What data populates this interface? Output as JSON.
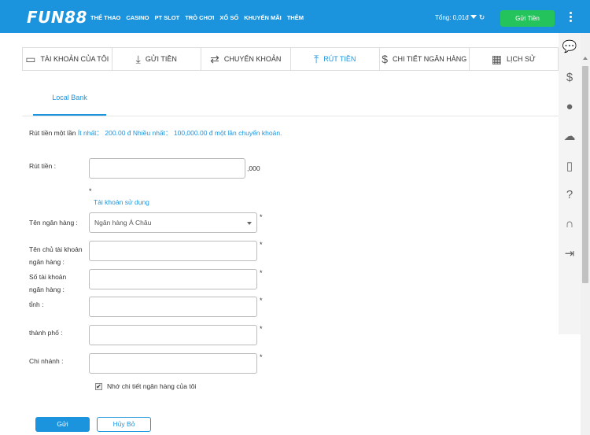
{
  "header": {
    "logo": "FUN88",
    "nav": [
      "THỂ THAO",
      "CASINO",
      "PT SLOT",
      "TRÒ CHƠI",
      "XỔ SỐ",
      "KHUYẾN MÃI",
      "THÊM"
    ],
    "balance": "Tổng: 0,01đ",
    "deposit_button": "Gửi Tiền"
  },
  "tabs": [
    {
      "label": "TÀI KHOẢN CỦA TÔI",
      "icon": "wallet-icon"
    },
    {
      "label": "GỬI TIỀN",
      "icon": "download-icon"
    },
    {
      "label": "CHUYỂN KHOẢN",
      "icon": "transfer-icon"
    },
    {
      "label": "RÚT TIỀN",
      "icon": "upload-icon",
      "active": true
    },
    {
      "label": "CHI TIẾT NGÂN HÀNG",
      "icon": "dollar-circle-icon"
    },
    {
      "label": "LỊCH SỬ",
      "icon": "calendar-icon"
    }
  ],
  "subtab": "Local Bank",
  "notice": {
    "prefix": "Rút tiền một lần",
    "min_label": "Ít nhất：",
    "min_value": "200.00 đ",
    "max_label": "Nhiều nhất：",
    "max_value": "100,000.00 đ một lần chuyển khoản."
  },
  "form": {
    "amount_label": "Rút tiền :",
    "amount_suffix": ",000",
    "account_asterisk": "*",
    "account_link": "Tài khoản sử dụng",
    "bank_label": "Tên ngân hàng :",
    "bank_selected": "Ngân hàng Á Châu",
    "holder_label_1": "Tên chủ tài khoản",
    "holder_label_2": "ngân hàng :",
    "number_label_1": "Số tài khoản",
    "number_label_2": "ngân hàng :",
    "province_label": "tỉnh :",
    "city_label": "thành phố :",
    "branch_label": "Chi nhánh :",
    "required_mark": "*",
    "remember_label": "Nhớ chi tiết ngân hàng của tôi",
    "remember_checked": true
  },
  "buttons": {
    "submit": "Gửi",
    "cancel": "Hủy Bỏ"
  },
  "sidebar_icons": [
    "chat-icon",
    "dollar-icon",
    "user-icon",
    "cloud-download-icon",
    "mobile-icon",
    "help-icon",
    "headset-icon",
    "logout-icon"
  ],
  "colors": {
    "brand": "#1c94dd",
    "deposit": "#24c35c"
  }
}
